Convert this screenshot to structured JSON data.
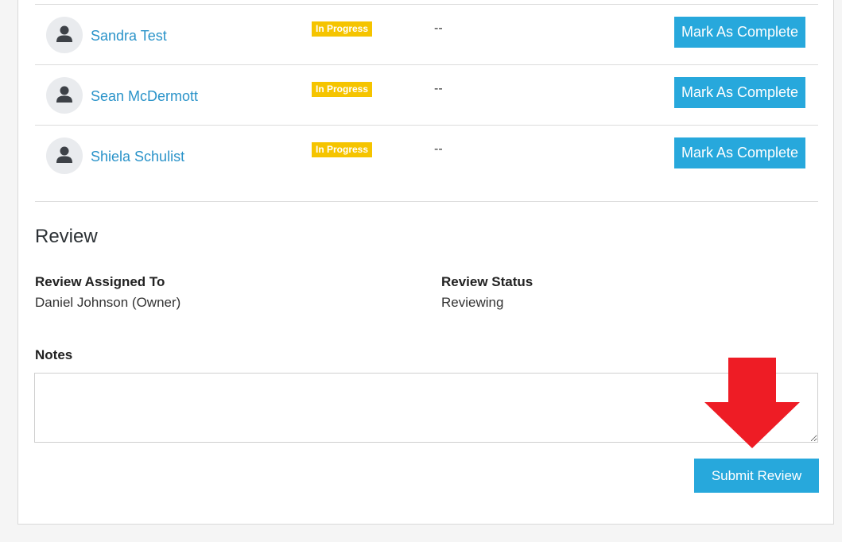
{
  "colors": {
    "link": "#2a93c9",
    "badge_in_progress": "#f5c400",
    "primary_button": "#27a8dc",
    "arrow": "#ee1c25"
  },
  "members": [
    {
      "name": "Sandra Test",
      "status": "In Progress",
      "completed": "--",
      "action": "Mark As Complete",
      "avatar_icon": "user-icon"
    },
    {
      "name": "Sean McDermott",
      "status": "In Progress",
      "completed": "--",
      "action": "Mark As Complete",
      "avatar_icon": "user-icon"
    },
    {
      "name": "Shiela Schulist",
      "status": "In Progress",
      "completed": "--",
      "action": "Mark As Complete",
      "avatar_icon": "user-icon"
    }
  ],
  "review": {
    "title": "Review",
    "assigned_label": "Review Assigned To",
    "assigned_value": "Daniel Johnson (Owner)",
    "status_label": "Review Status",
    "status_value": "Reviewing",
    "notes_label": "Notes",
    "notes_value": "",
    "submit_label": "Submit Review"
  },
  "annotation": {
    "icon": "arrow-down-icon",
    "color": "#ee1c25"
  }
}
